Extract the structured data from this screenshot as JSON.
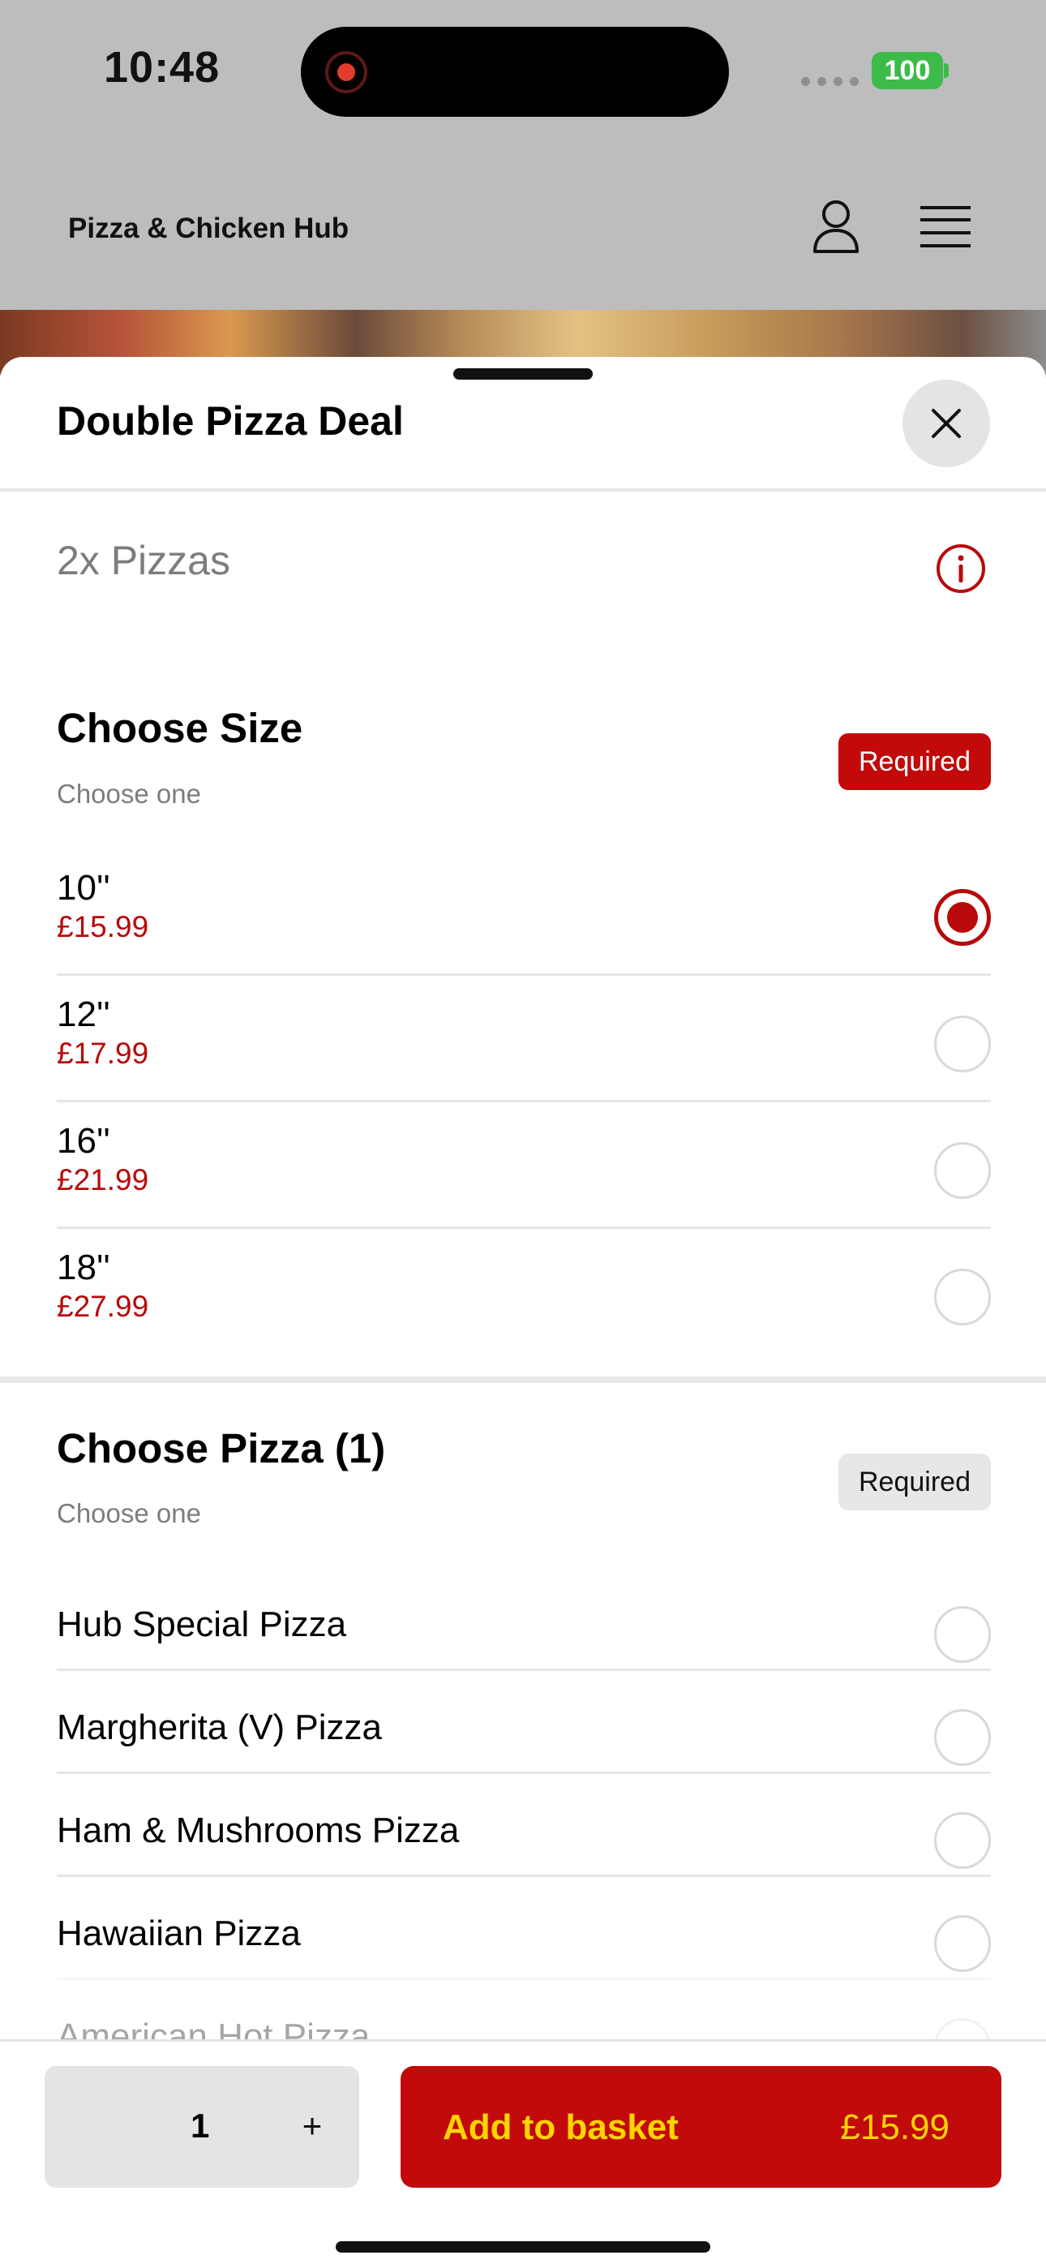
{
  "status_bar": {
    "time": "10:48",
    "battery": "100"
  },
  "header": {
    "brand": "Pizza & Chicken Hub"
  },
  "sheet": {
    "title": "Double Pizza Deal",
    "description": "2x Pizzas",
    "sections": [
      {
        "title": "Choose Size",
        "subtitle": "Choose one",
        "badge": "Required",
        "badge_state": "active-red",
        "options": [
          {
            "label": "10''",
            "price": "£15.99",
            "selected": true
          },
          {
            "label": "12''",
            "price": "£17.99",
            "selected": false
          },
          {
            "label": "16''",
            "price": "£21.99",
            "selected": false
          },
          {
            "label": "18''",
            "price": "£27.99",
            "selected": false
          }
        ]
      },
      {
        "title": "Choose Pizza (1)",
        "subtitle": "Choose one",
        "badge": "Required",
        "badge_state": "grey",
        "options": [
          {
            "label": "Hub Special Pizza",
            "selected": false
          },
          {
            "label": "Margherita (V) Pizza",
            "selected": false
          },
          {
            "label": "Ham & Mushrooms Pizza",
            "selected": false
          },
          {
            "label": "Hawaiian Pizza",
            "selected": false
          },
          {
            "label": "American Hot Pizza",
            "selected": false
          }
        ]
      }
    ]
  },
  "bottom_bar": {
    "quantity": "1",
    "plus_label": "+",
    "add_label": "Add to basket",
    "add_price": "£15.99"
  },
  "colors": {
    "accent_red": "#c20a0a",
    "price_red": "#b80a0a",
    "button_text_yellow": "#ffd400",
    "battery_green": "#3cbb4b"
  },
  "icons": [
    "record-icon",
    "user-icon",
    "menu-icon",
    "close-icon",
    "info-icon",
    "plus-icon"
  ]
}
